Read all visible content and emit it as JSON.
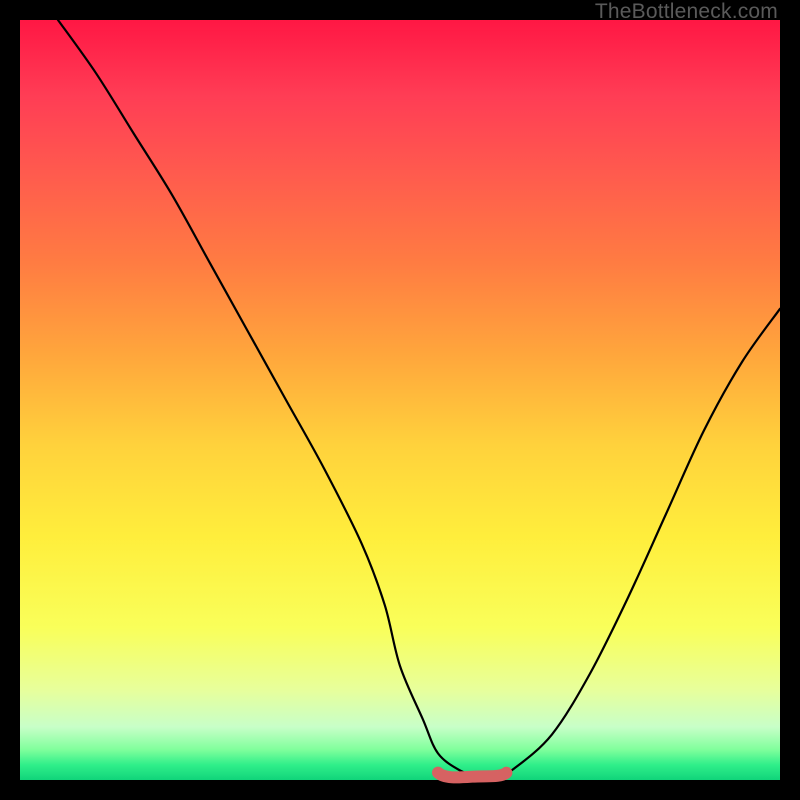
{
  "watermark": "TheBottleneck.com",
  "chart_data": {
    "type": "line",
    "title": "",
    "xlabel": "",
    "ylabel": "",
    "xlim": [
      0,
      100
    ],
    "ylim": [
      0,
      100
    ],
    "x": [
      5,
      10,
      15,
      20,
      25,
      30,
      35,
      40,
      45,
      48,
      50,
      53,
      55,
      58,
      60,
      63,
      65,
      70,
      75,
      80,
      85,
      90,
      95,
      100
    ],
    "values": [
      100,
      93,
      85,
      77,
      68,
      59,
      50,
      41,
      31,
      23,
      15,
      8,
      3.5,
      1.2,
      0.7,
      0.7,
      1.5,
      6,
      14,
      24,
      35,
      46,
      55,
      62
    ],
    "highlight_region": {
      "x_start": 55,
      "x_end": 64,
      "y": 0.7
    }
  }
}
